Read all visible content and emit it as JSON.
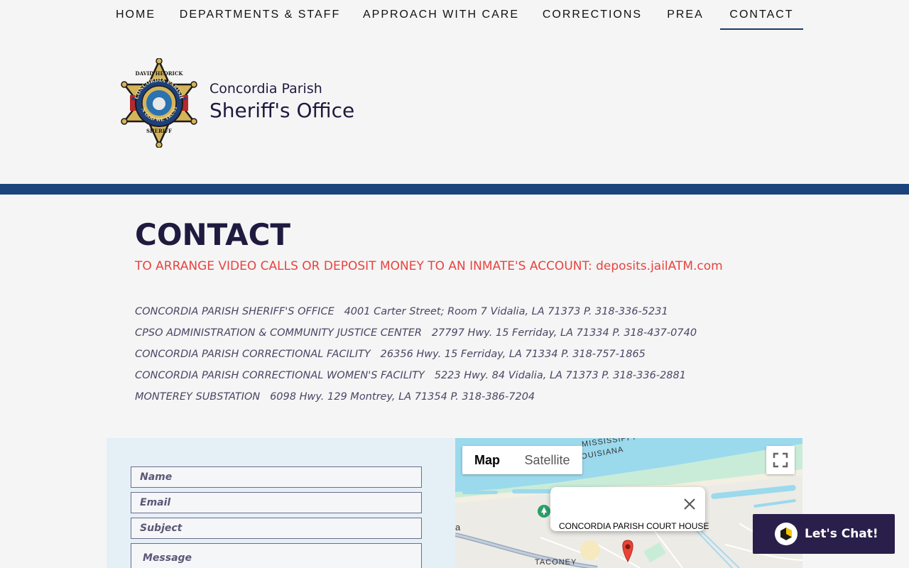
{
  "nav": {
    "items": [
      {
        "label": "HOME"
      },
      {
        "label": "DEPARTMENTS & STAFF"
      },
      {
        "label": "APPROACH WITH CARE"
      },
      {
        "label": "CORRECTIONS"
      },
      {
        "label": "PREA"
      },
      {
        "label": "CONTACT"
      }
    ],
    "active": "CONTACT"
  },
  "header": {
    "badge_top": "DAVID HEDRICK",
    "badge_ring": "CONCORDIA PARISH",
    "badge_motto": "IN GOD WE TRUST",
    "badge_bottom": "SHERIFF",
    "brand_line1": "Concordia Parish",
    "brand_line2": "Sheriff's Office"
  },
  "main": {
    "title": "CONTACT",
    "notice": "TO ARRANGE VIDEO CALLS OR DEPOSIT MONEY TO AN INMATE'S ACCOUNT: deposits.jailATM.com",
    "locations": [
      {
        "name": "CONCORDIA PARISH SHERIFF'S OFFICE",
        "details": "4001 Carter Street; Room 7 Vidalia, LA 71373 P. 318-336-5231"
      },
      {
        "name": "CPSO ADMINISTRATION & COMMUNITY JUSTICE CENTER",
        "details": "27797 Hwy. 15 Ferriday, LA 71334 P. 318-437-0740"
      },
      {
        "name": "CONCORDIA PARISH CORRECTIONAL FACILITY",
        "details": "26356 Hwy. 15 Ferriday, LA 71334 P. 318-757-1865"
      },
      {
        "name": "CONCORDIA PARISH CORRECTIONAL WOMEN'S FACILITY",
        "details": "5223 Hwy. 84 Vidalia, LA 71373 P. 318-336-2881"
      },
      {
        "name": "MONTEREY SUBSTATION",
        "details": "6098 Hwy. 129 Montrey, LA 71354 P. 318-386-7204"
      }
    ]
  },
  "form": {
    "name_placeholder": "Name",
    "email_placeholder": "Email",
    "subject_placeholder": "Subject",
    "message_placeholder": "Message"
  },
  "map": {
    "map_label": "Map",
    "satellite_label": "Satellite",
    "popup_label": "CONCORDIA PARISH COURT HOUSE",
    "label_state1": "MISSISSIPPI",
    "label_state2": "LOUISIANA",
    "label_area": "TACONEY",
    "label_edge": "a"
  },
  "chat": {
    "label": "Let's Chat!"
  },
  "colors": {
    "navy": "#1b447c",
    "brand_text": "#1f1a3f",
    "notice_red": "#e8433f",
    "chat_bg": "#2a1f4b",
    "form_bg": "#e4f0f6"
  }
}
